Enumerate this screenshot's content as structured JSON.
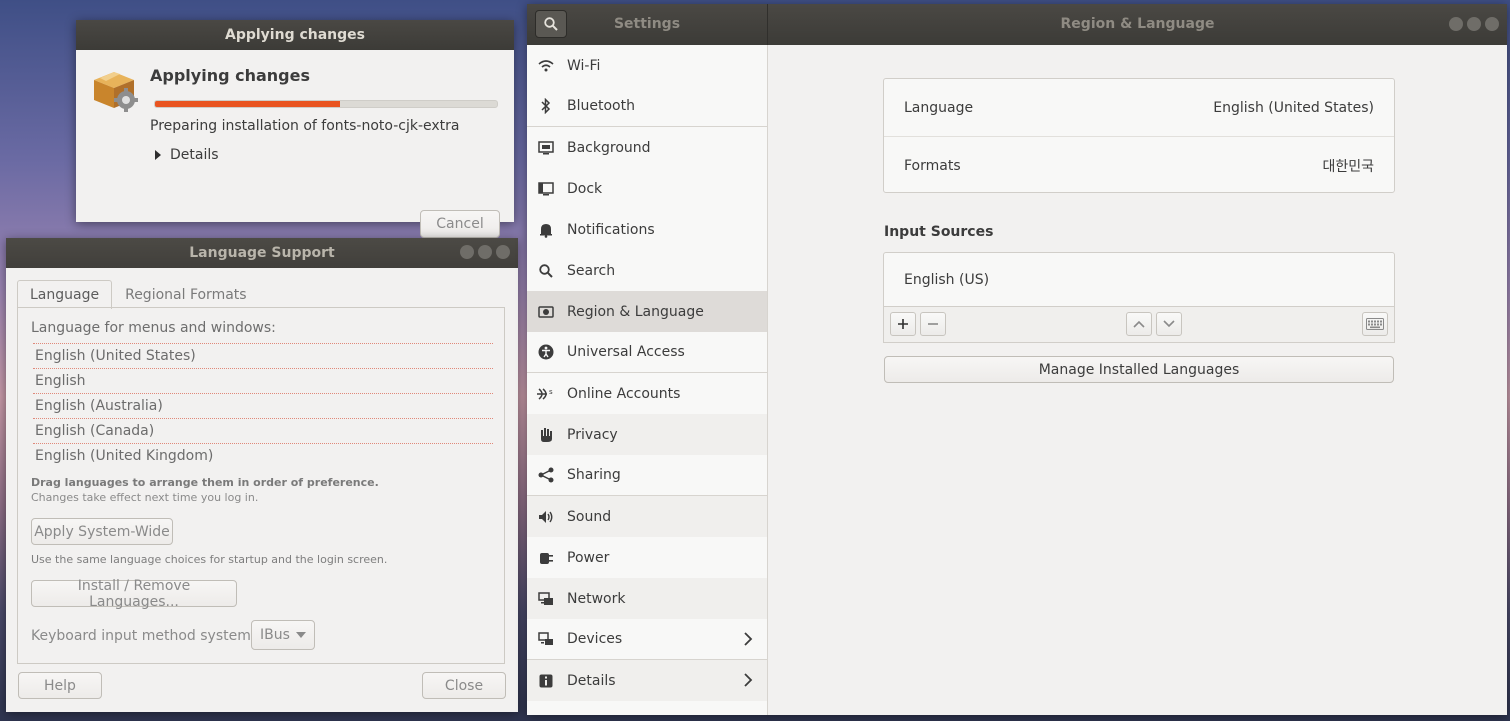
{
  "apply": {
    "window_title": "Applying changes",
    "heading": "Applying changes",
    "progress_fraction": 0.54,
    "status": "Preparing installation of fonts-noto-cjk-extra",
    "details_label": "Details",
    "cancel_label": "Cancel"
  },
  "langsupport": {
    "window_title": "Language Support",
    "tabs": [
      {
        "label": "Language"
      },
      {
        "label": "Regional Formats"
      }
    ],
    "menu_label": "Language for menus and windows:",
    "languages": [
      "English (United States)",
      "English",
      "English (Australia)",
      "English (Canada)",
      "English (United Kingdom)"
    ],
    "drag_hint": "Drag languages to arrange them in order of preference.",
    "changes_hint": "Changes take effect next time you log in.",
    "apply_label": "Apply System-Wide",
    "same_choices": "Use the same language choices for startup and the login screen.",
    "install_label": "Install / Remove Languages...",
    "kbd_label": "Keyboard input method system:",
    "kbd_value": "IBus",
    "help_label": "Help",
    "close_label": "Close"
  },
  "settings": {
    "app_title": "Settings",
    "page_title": "Region & Language",
    "sidebar": [
      {
        "label": "Wi-Fi",
        "icon": "wifi-icon"
      },
      {
        "label": "Bluetooth",
        "icon": "bluetooth-icon"
      },
      {
        "label": "Background",
        "icon": "background-icon"
      },
      {
        "label": "Dock",
        "icon": "dock-icon"
      },
      {
        "label": "Notifications",
        "icon": "bell-icon"
      },
      {
        "label": "Search",
        "icon": "search-icon"
      },
      {
        "label": "Region & Language",
        "icon": "region-icon"
      },
      {
        "label": "Universal Access",
        "icon": "accessibility-icon"
      },
      {
        "label": "Online Accounts",
        "icon": "online-accounts-icon"
      },
      {
        "label": "Privacy",
        "icon": "hand-icon"
      },
      {
        "label": "Sharing",
        "icon": "share-icon"
      },
      {
        "label": "Sound",
        "icon": "speaker-icon"
      },
      {
        "label": "Power",
        "icon": "power-icon"
      },
      {
        "label": "Network",
        "icon": "network-icon"
      },
      {
        "label": "Devices",
        "icon": "devices-icon"
      },
      {
        "label": "Details",
        "icon": "info-icon"
      }
    ],
    "language_label": "Language",
    "language_value": "English (United States)",
    "formats_label": "Formats",
    "formats_value": "대한민국",
    "input_sources_heading": "Input Sources",
    "input_sources": [
      "English (US)"
    ],
    "manage_label": "Manage Installed Languages"
  }
}
